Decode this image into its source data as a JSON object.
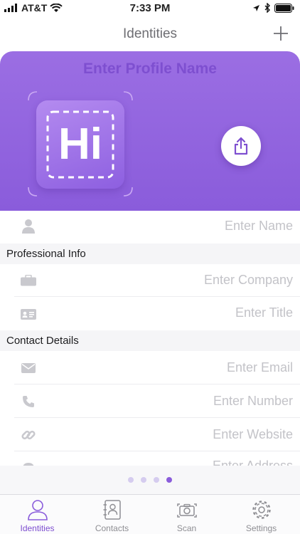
{
  "status_bar": {
    "carrier": "AT&T",
    "time": "7:33 PM"
  },
  "nav": {
    "title": "Identities"
  },
  "header": {
    "profile_name_placeholder": "Enter Profile Name",
    "logo_text": "Hi"
  },
  "fields": {
    "name": "Enter Name",
    "company": "Enter Company",
    "title": "Enter Title",
    "email": "Enter Email",
    "number": "Enter Number",
    "website": "Enter Website",
    "address": "Enter Address"
  },
  "sections": {
    "professional": "Professional Info",
    "contact": "Contact Details"
  },
  "pager": {
    "pages": 4,
    "current": 4
  },
  "tabs": [
    {
      "label": "Identities",
      "icon": "person-icon",
      "active": true
    },
    {
      "label": "Contacts",
      "icon": "contact-book-icon",
      "active": false
    },
    {
      "label": "Scan",
      "icon": "camera-icon",
      "active": false
    },
    {
      "label": "Settings",
      "icon": "gear-icon",
      "active": false
    }
  ],
  "colors": {
    "accent": "#8a5cdb",
    "placeholder": "#c3c3c8"
  }
}
